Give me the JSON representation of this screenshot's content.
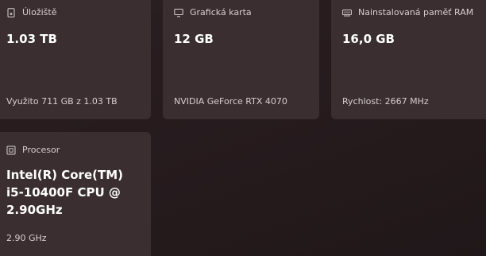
{
  "storage": {
    "icon": "storage-icon",
    "label": "Úložiště",
    "value": "1.03 TB",
    "detail": "Využito 711 GB z 1.03 TB"
  },
  "gpu": {
    "icon": "display-icon",
    "label": "Grafická karta",
    "value": "12 GB",
    "detail": "NVIDIA GeForce RTX 4070"
  },
  "ram": {
    "icon": "memory-icon",
    "label": "Nainstalovaná paměť RAM",
    "value": "16,0 GB",
    "detail": "Rychlost: 2667 MHz"
  },
  "cpu": {
    "icon": "processor-icon",
    "label": "Procesor",
    "value_lines": [
      "Intel(R) Core(TM)",
      "i5-10400F CPU @",
      "2.90GHz"
    ],
    "detail": "2.90 GHz"
  }
}
